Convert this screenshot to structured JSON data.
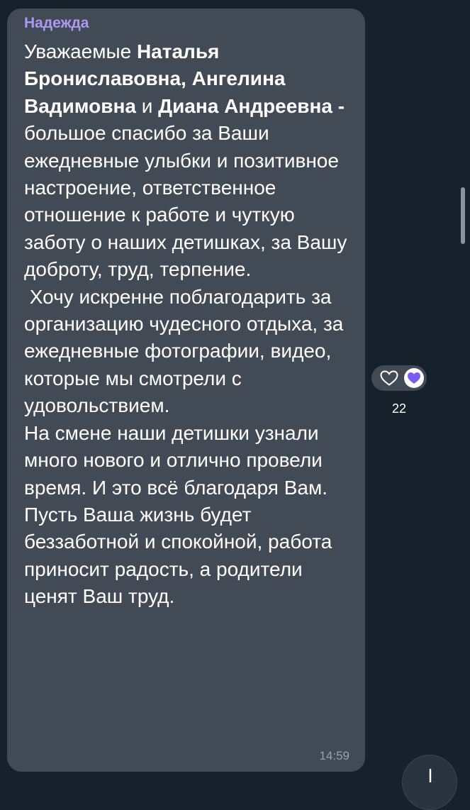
{
  "message": {
    "sender": "Надежда",
    "time": "14:59",
    "text": {
      "p01": "Уважаемые ",
      "b01": "Наталья Брониславовна, Ангелина Вадимовна",
      "p02": " и ",
      "b02": "Диана Андреевна - ",
      "p03": " большое спасибо за Ваши ежедневные улыбки и позитивное настроение, ответственное отношение к работе и чуткую заботу о наших детишках, за Вашу доброту, труд, терпение.\n Хочу искренне поблагодарить за организацию чудесного отдыха, за ежедневные фотографии, видео, которые мы смотрели с удовольствием.\nНа смене наши детишки узнали много нового и отлично провели время. И это всё благодаря Вам.\nПусть Ваша жизнь будет беззаботной и спокойной, работа приносит радость, а родители ценят Ваш труд."
    }
  },
  "reaction": {
    "icon": "heart-outline-icon",
    "selected_icon": "purple-heart-icon",
    "count": "22"
  },
  "scroll_down_icon": "arrow-down-icon",
  "colors": {
    "background": "#17212b",
    "bubble": "#424a55",
    "sender": "#a99af0",
    "heart_purple": "#7b5cf0"
  }
}
